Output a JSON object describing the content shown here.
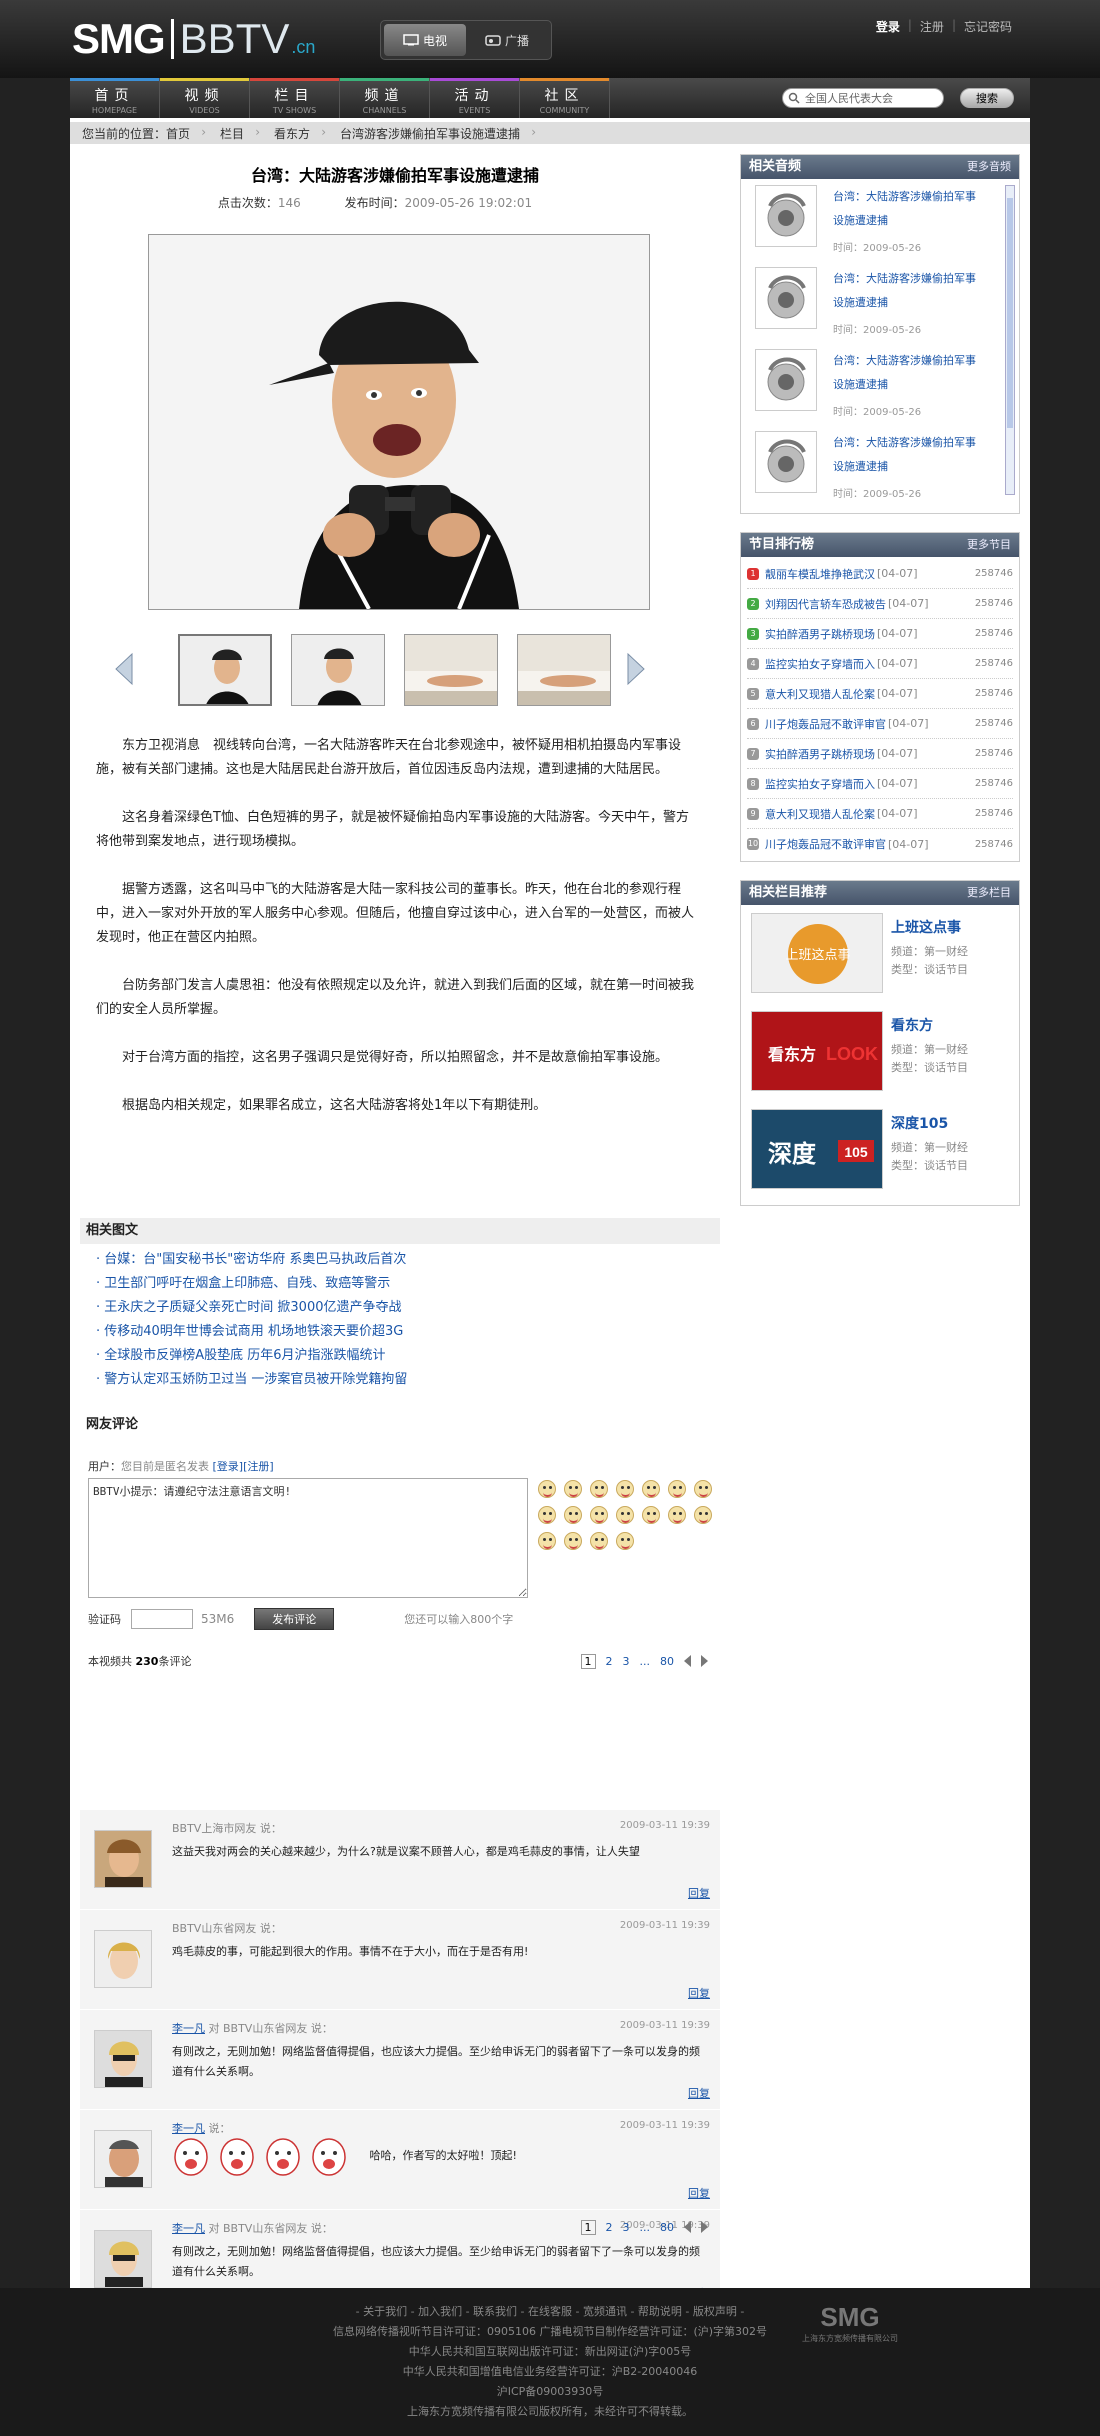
{
  "header": {
    "logo_smg": "SMG",
    "logo_bbtv": "BBTV",
    "logo_cn": ".cn",
    "tabs": [
      "电视",
      "广播"
    ],
    "login": "登录",
    "register": "注册",
    "forgot": "忘记密码"
  },
  "nav": {
    "items": [
      {
        "label": "首页",
        "sub": "HOMEPAGE",
        "color": "#3b8fd6"
      },
      {
        "label": "视频",
        "sub": "VIDEOS",
        "color": "#e2c93a"
      },
      {
        "label": "栏目",
        "sub": "TV SHOWS",
        "color": "#d6463b"
      },
      {
        "label": "频道",
        "sub": "CHANNELS",
        "color": "#3bb27a"
      },
      {
        "label": "活动",
        "sub": "EVENTS",
        "color": "#a84bd6"
      },
      {
        "label": "社区",
        "sub": "COMMUNITY",
        "color": "#e38a2c"
      }
    ],
    "search_placeholder": "全国人民代表大会",
    "search_button": "搜索"
  },
  "breadcrumb": [
    "您当前的位置：首页",
    "栏目",
    "看东方",
    "台湾游客涉嫌偷拍军事设施遭逮捕"
  ],
  "article": {
    "title": "台湾：大陆游客涉嫌偷拍军事设施遭逮捕",
    "clicks_label": "点击次数：",
    "clicks_value": "146",
    "time_label": "发布时间：",
    "time_value": "2009-05-26 19:02:01",
    "paragraphs": [
      "东方卫视消息　视线转向台湾，一名大陆游客昨天在台北参观途中，被怀疑用相机拍摄岛内军事设施，被有关部门逮捕。这也是大陆居民赴台游开放后，首位因违反岛内法规，遭到逮捕的大陆居民。",
      "这名身着深绿色T恤、白色短裤的男子，就是被怀疑偷拍岛内军事设施的大陆游客。今天中午，警方将他带到案发地点，进行现场模拟。",
      "据警方透露，这名叫马中飞的大陆游客是大陆一家科技公司的董事长。昨天，他在台北的参观行程中，进入一家对外开放的军人服务中心参观。但随后，他擅自穿过该中心，进入台军的一处营区，而被人发现时，他正在营区内拍照。",
      "台防务部门发言人虞思祖：他没有依照规定以及允许，就进入到我们后面的区域，就在第一时间被我们的安全人员所掌握。",
      "对于台湾方面的指控，这名男子强调只是觉得好奇，所以拍照留念，并不是故意偷拍军事设施。",
      "根据岛内相关规定，如果罪名成立，这名大陆游客将处1年以下有期徒刑。"
    ]
  },
  "related_pics": {
    "title": "相关图文",
    "items": [
      "台媒：台\"国安秘书长\"密访华府 系奥巴马执政后首次",
      "卫生部门呼吁在烟盒上印肺癌、自残、致癌等警示",
      "王永庆之子质疑父亲死亡时间 掀3000亿遗产争夺战",
      "传移动40明年世博会试商用 机场地铁滚天要价超3G",
      "全球股市反弹榜A股垫底 历年6月沪指涨跌幅统计",
      "警方认定邓玉娇防卫过当 一涉案官员被开除党籍拘留"
    ]
  },
  "comment_form": {
    "title": "网友评论",
    "user_label": "用户：",
    "anon_text": "您目前是匿名发表",
    "login_link": "[登录]",
    "register_link": "[注册]",
    "textarea_value": "BBTV小提示：请遵纪守法注意语言文明!",
    "code_label": "验证码",
    "code_value": "53M6",
    "submit": "发布评论",
    "hint": "您还可以输入800个字"
  },
  "pager": {
    "total_prefix": "本视频共 ",
    "total_count": "230",
    "total_suffix": "条评论",
    "pages": [
      "1",
      "2",
      "3",
      "...",
      "80"
    ]
  },
  "comments": [
    {
      "who": "BBTV上海市网友",
      "link": "",
      "mid": "",
      "suffix": " 说：",
      "time": "2009-03-11 19:39",
      "text": "这益天我对两会的关心越来越少，为什么?就是议案不顾普人心，都是鸡毛蒜皮的事情，让人失望"
    },
    {
      "who": "BBTV山东省网友",
      "link": "",
      "mid": "",
      "suffix": " 说：",
      "time": "2009-03-11 19:39",
      "text": "鸡毛蒜皮的事，可能起到很大的作用。事情不在于大小，而在于是否有用!"
    },
    {
      "who": "",
      "link": "李一凡",
      "mid": " 对 BBTV山东省网友",
      "suffix": " 说：",
      "time": "2009-03-11 19:39",
      "text": "有则改之，无则加勉！网络监督值得提倡，也应该大力提倡。至少给申诉无门的弱者留下了一条可以发身的频道有什么关系啊。"
    },
    {
      "who": "",
      "link": "李一凡",
      "mid": "",
      "suffix": " 说：",
      "time": "2009-03-11 19:39",
      "text": "哈哈，作者写的太好啦！顶起!"
    },
    {
      "who": "",
      "link": "李一凡",
      "mid": " 对 BBTV山东省网友",
      "suffix": " 说：",
      "time": "2009-03-11 19:39",
      "text": "有则改之，无则加勉！网络监督值得提倡，也应该大力提倡。至少给申诉无门的弱者留下了一条可以发身的频道有什么关系啊。"
    }
  ],
  "reply_label": "回复",
  "sidebar": {
    "audio": {
      "title": "相关音频",
      "more": "更多音频",
      "items": [
        {
          "title": "台湾：大陆游客涉嫌偷拍军事设施遭逮捕",
          "date": "时间：2009-05-26"
        },
        {
          "title": "台湾：大陆游客涉嫌偷拍军事设施遭逮捕",
          "date": "时间：2009-05-26"
        },
        {
          "title": "台湾：大陆游客涉嫌偷拍军事设施遭逮捕",
          "date": "时间：2009-05-26"
        },
        {
          "title": "台湾：大陆游客涉嫌偷拍军事设施遭逮捕",
          "date": "时间：2009-05-26"
        }
      ]
    },
    "ranking": {
      "title": "节目排行榜",
      "more": "更多节目",
      "items": [
        {
          "num": "1",
          "name": "靓丽车模乱堆挣艳武汉",
          "date": "[04-07]",
          "count": "258746",
          "color": "#d33"
        },
        {
          "num": "2",
          "name": "刘翔因代言轿车恐成被告",
          "date": "[04-07]",
          "count": "258746",
          "color": "#4a4"
        },
        {
          "num": "3",
          "name": "实拍醉酒男子跳桥现场",
          "date": "[04-07]",
          "count": "258746",
          "color": "#4a4"
        },
        {
          "num": "4",
          "name": "监控实拍女子穿墙而入",
          "date": "[04-07]",
          "count": "258746",
          "color": "#999"
        },
        {
          "num": "5",
          "name": "意大利又现猎人乱伦案",
          "date": "[04-07]",
          "count": "258746",
          "color": "#999"
        },
        {
          "num": "6",
          "name": "川子炮轰品冠不敢评审官",
          "date": "[04-07]",
          "count": "258746",
          "color": "#999"
        },
        {
          "num": "7",
          "name": "实拍醉酒男子跳桥现场",
          "date": "[04-07]",
          "count": "258746",
          "color": "#999"
        },
        {
          "num": "8",
          "name": "监控实拍女子穿墙而入",
          "date": "[04-07]",
          "count": "258746",
          "color": "#999"
        },
        {
          "num": "9",
          "name": "意大利又现猎人乱伦案",
          "date": "[04-07]",
          "count": "258746",
          "color": "#999"
        },
        {
          "num": "10",
          "name": "川子炮轰品冠不敢评审官",
          "date": "[04-07]",
          "count": "258746",
          "color": "#999"
        }
      ]
    },
    "programs": {
      "title": "相关栏目推荐",
      "more": "更多栏目",
      "items": [
        {
          "name": "上班这点事",
          "channel": "频道：第一财经",
          "type": "类型：谈话节目",
          "img_text": "上班这点事"
        },
        {
          "name": "看东方",
          "channel": "频道：第一财经",
          "type": "类型：谈话节目",
          "img_text": "看东方"
        },
        {
          "name": "深度105",
          "channel": "频道：第一财经",
          "type": "类型：谈话节目",
          "img_text": "深度"
        }
      ]
    }
  },
  "footer": {
    "links": "- 关于我们 - 加入我们 - 联系我们 - 在线客服 - 宽频通讯 - 帮助说明 - 版权声明 -",
    "lines": [
      "信息网络传播视听节目许可证：0905106 广播电视节目制作经营许可证：(沪)字第302号",
      "中华人民共和国互联网出版许可证：新出网证(沪)字005号",
      "中华人民共和国增值电信业务经营许可证：沪B2-20040046",
      "沪ICP备09003930号",
      "上海东方宽频传播有限公司版权所有，未经许可不得转载。"
    ],
    "logo": "SMG",
    "logo_cn": "上海东方宽频传播有限公司"
  }
}
